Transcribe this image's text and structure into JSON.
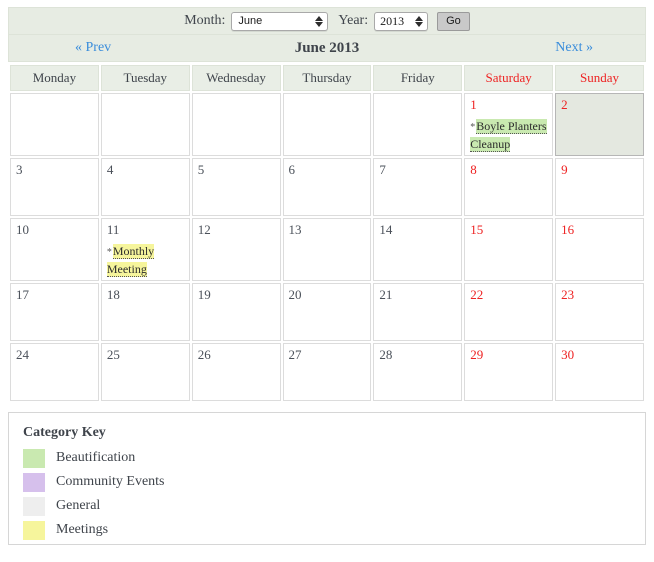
{
  "toolbar": {
    "month_label": "Month:",
    "month_value": "June",
    "year_label": "Year:",
    "year_value": "2013",
    "go_label": "Go"
  },
  "nav": {
    "prev_label": "« Prev",
    "next_label": "Next »",
    "title": "June 2013"
  },
  "weekdays": [
    {
      "label": "Monday",
      "weekend": false
    },
    {
      "label": "Tuesday",
      "weekend": false
    },
    {
      "label": "Wednesday",
      "weekend": false
    },
    {
      "label": "Thursday",
      "weekend": false
    },
    {
      "label": "Friday",
      "weekend": false
    },
    {
      "label": "Saturday",
      "weekend": true
    },
    {
      "label": "Sunday",
      "weekend": true
    }
  ],
  "weeks": [
    [
      {
        "day": "",
        "empty": true
      },
      {
        "day": "",
        "empty": true
      },
      {
        "day": "",
        "empty": true
      },
      {
        "day": "",
        "empty": true
      },
      {
        "day": "",
        "empty": true
      },
      {
        "day": "1",
        "weekend": true,
        "events": [
          {
            "title": "Boyle Planters Cleanup",
            "category": "beautification",
            "bullet": "*"
          }
        ]
      },
      {
        "day": "2",
        "weekend": true,
        "today": true
      }
    ],
    [
      {
        "day": "3"
      },
      {
        "day": "4"
      },
      {
        "day": "5"
      },
      {
        "day": "6"
      },
      {
        "day": "7"
      },
      {
        "day": "8",
        "weekend": true
      },
      {
        "day": "9",
        "weekend": true
      }
    ],
    [
      {
        "day": "10"
      },
      {
        "day": "11",
        "events": [
          {
            "title": "Monthly Meeting",
            "category": "meetings",
            "bullet": "*"
          }
        ]
      },
      {
        "day": "12"
      },
      {
        "day": "13"
      },
      {
        "day": "14"
      },
      {
        "day": "15",
        "weekend": true
      },
      {
        "day": "16",
        "weekend": true
      }
    ],
    [
      {
        "day": "17"
      },
      {
        "day": "18"
      },
      {
        "day": "19"
      },
      {
        "day": "20"
      },
      {
        "day": "21"
      },
      {
        "day": "22",
        "weekend": true
      },
      {
        "day": "23",
        "weekend": true
      }
    ],
    [
      {
        "day": "24"
      },
      {
        "day": "25"
      },
      {
        "day": "26"
      },
      {
        "day": "27"
      },
      {
        "day": "28"
      },
      {
        "day": "29",
        "weekend": true
      },
      {
        "day": "30",
        "weekend": true
      }
    ]
  ],
  "category_key": {
    "title": "Category Key",
    "items": [
      {
        "label": "Beautification",
        "color": "#c9e9b0"
      },
      {
        "label": "Community Events",
        "color": "#d6c0ec"
      },
      {
        "label": "General",
        "color": "#eeeeee"
      },
      {
        "label": "Meetings",
        "color": "#f6f59c"
      }
    ]
  }
}
